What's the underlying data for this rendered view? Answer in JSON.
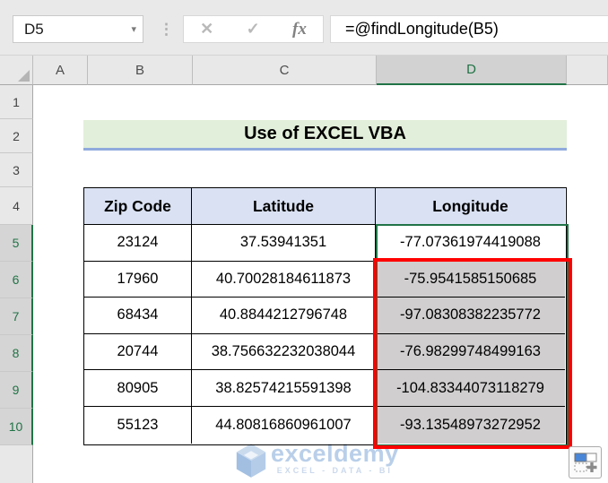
{
  "formula_bar": {
    "name_box_value": "D5",
    "formula": "=@findLongitude(B5)",
    "icons": {
      "namebox_caret": "▾",
      "more_dots": "⋮",
      "cancel": "✕",
      "enter": "✓",
      "insert_function": "fx"
    }
  },
  "sheet": {
    "columns": [
      "A",
      "B",
      "C",
      "D"
    ],
    "selected_column": "D",
    "rows": [
      "1",
      "2",
      "3",
      "4",
      "5",
      "6",
      "7",
      "8",
      "9",
      "10"
    ],
    "selected_rows": [
      "5",
      "6",
      "7",
      "8",
      "9",
      "10"
    ],
    "active_cell": "D5"
  },
  "banner": {
    "text": "Use of EXCEL VBA",
    "bg_color": "#e2efda",
    "border_color": "#8faadc"
  },
  "table": {
    "headers": [
      "Zip Code",
      "Latitude",
      "Longitude"
    ],
    "rows": [
      {
        "zip": "23124",
        "lat": "37.53941351",
        "lng": "-77.07361974419088"
      },
      {
        "zip": "17960",
        "lat": "40.70028184611873",
        "lng": "-75.9541585150685"
      },
      {
        "zip": "68434",
        "lat": "40.8844212796748",
        "lng": "-97.08308382235772"
      },
      {
        "zip": "20744",
        "lat": "38.756632232038044",
        "lng": "-76.98299748499163"
      },
      {
        "zip": "80905",
        "lat": "38.82574215591398",
        "lng": "-104.83344073118279"
      },
      {
        "zip": "55123",
        "lat": "44.80816860961007",
        "lng": "-93.13548973272952"
      }
    ],
    "header_bg": "#d9e1f2",
    "highlight_bg": "#d0cece",
    "selection_color": "#217346",
    "annotation_color": "#ff0000"
  },
  "watermark": {
    "brand": "exceldemy",
    "tagline": "EXCEL - DATA - BI",
    "color": "#b8cce4"
  }
}
